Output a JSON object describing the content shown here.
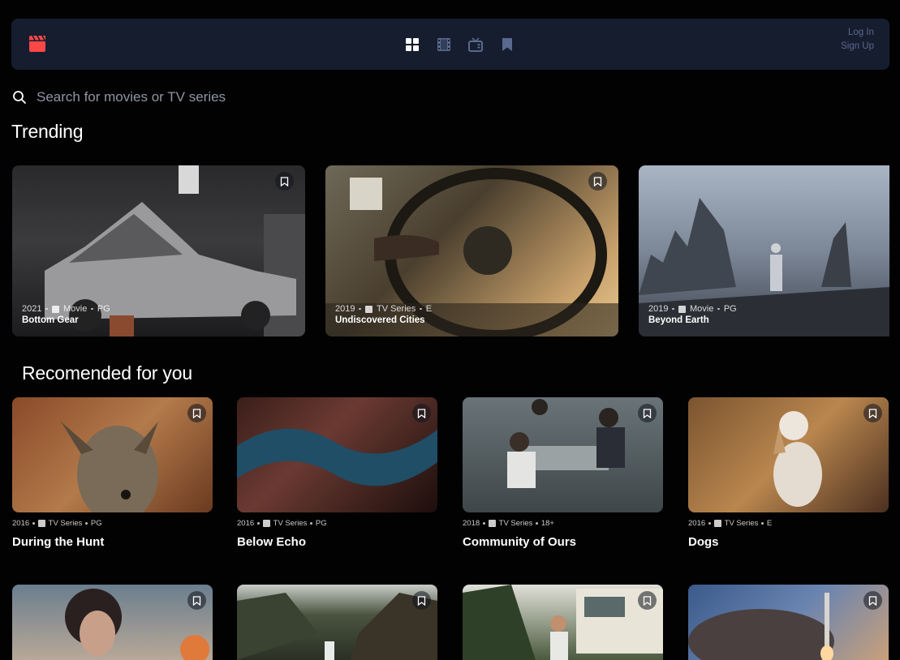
{
  "nav": {
    "logo_icon": "clapperboard-icon",
    "icons": [
      "grid-icon",
      "film-icon",
      "tv-icon",
      "bookmark-icon"
    ],
    "login_label": "Log In",
    "signup_label": "Sign Up"
  },
  "search": {
    "placeholder": "Search for movies or TV series"
  },
  "trending": {
    "title": "Trending",
    "items": [
      {
        "year": "2021",
        "category": "Movie",
        "rating": "PG",
        "title": "Bottom Gear"
      },
      {
        "year": "2019",
        "category": "TV Series",
        "rating": "E",
        "title": "Undiscovered Cities"
      },
      {
        "year": "2019",
        "category": "Movie",
        "rating": "PG",
        "title": "Beyond Earth"
      }
    ]
  },
  "recommended": {
    "title": "Recomended for you",
    "items": [
      {
        "year": "2016",
        "category": "TV Series",
        "rating": "PG",
        "title": "During the Hunt"
      },
      {
        "year": "2016",
        "category": "TV Series",
        "rating": "PG",
        "title": "Below Echo"
      },
      {
        "year": "2018",
        "category": "TV Series",
        "rating": "18+",
        "title": "Community of Ours"
      },
      {
        "year": "2016",
        "category": "TV Series",
        "rating": "E",
        "title": "Dogs"
      }
    ]
  },
  "colors": {
    "background": "#020203",
    "nav": "#161d2f",
    "accent": "#fc4747",
    "muted": "#5a698f"
  }
}
